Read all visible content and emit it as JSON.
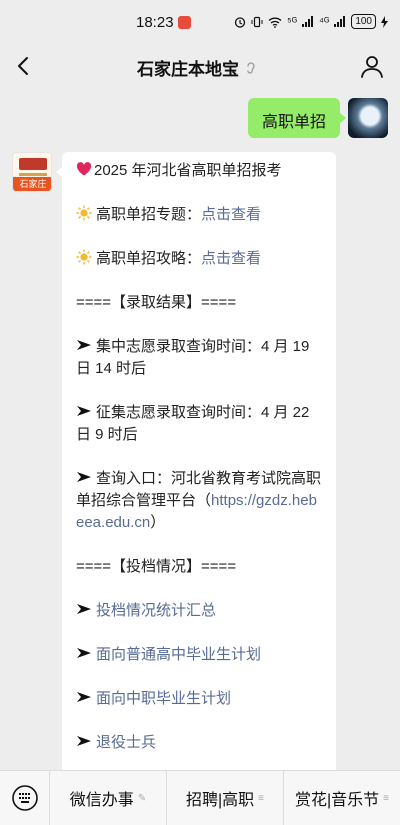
{
  "status_bar": {
    "time": "18:23",
    "signal_text": "⁵ᴳ",
    "signal_text2": "⁴ᴳ",
    "battery": "100"
  },
  "nav": {
    "title": "石家庄本地宝"
  },
  "chat": {
    "user_message": "高职单招",
    "brand_avatar_label": "石家庄",
    "lines": [
      {
        "prefix": "heart-icon",
        "text": "2025 年河北省高职单招报考"
      },
      {
        "prefix": "sun-icon",
        "text": "高职单招专题：",
        "link": "点击查看"
      },
      {
        "prefix": "sun-icon",
        "text": "高职单招攻略：",
        "link": "点击查看"
      },
      {
        "text": "====【录取结果】===="
      },
      {
        "prefix": "arrow-icon",
        "text": "集中志愿录取查询时间：4 月 19 日 14 时后"
      },
      {
        "prefix": "arrow-icon",
        "text": "征集志愿录取查询时间：4 月 22 日 9 时后"
      },
      {
        "prefix": "arrow-icon",
        "text": "查询入口：河北省教育考试院高职单招综合管理平台（",
        "link": "https://gzdz.hebeea.edu.cn",
        "suffix": "）"
      },
      {
        "text": "====【投档情况】===="
      },
      {
        "prefix": "arrow-icon",
        "link": "投档情况统计汇总"
      },
      {
        "prefix": "arrow-icon",
        "link": "面向普通高中毕业生计划"
      },
      {
        "prefix": "arrow-icon",
        "link": "面向中职毕业生计划"
      },
      {
        "prefix": "arrow-icon",
        "link": "退役士兵"
      }
    ]
  },
  "bottom_menu": {
    "items": [
      {
        "label": "微信办事",
        "mark": "✎"
      },
      {
        "label": "招聘|高职",
        "mark": "≡"
      },
      {
        "label": "赏花|音乐节",
        "mark": "≡"
      }
    ]
  },
  "colors": {
    "bubble_green": "#95ec69",
    "link_blue": "#576b95",
    "background": "#ededed"
  }
}
